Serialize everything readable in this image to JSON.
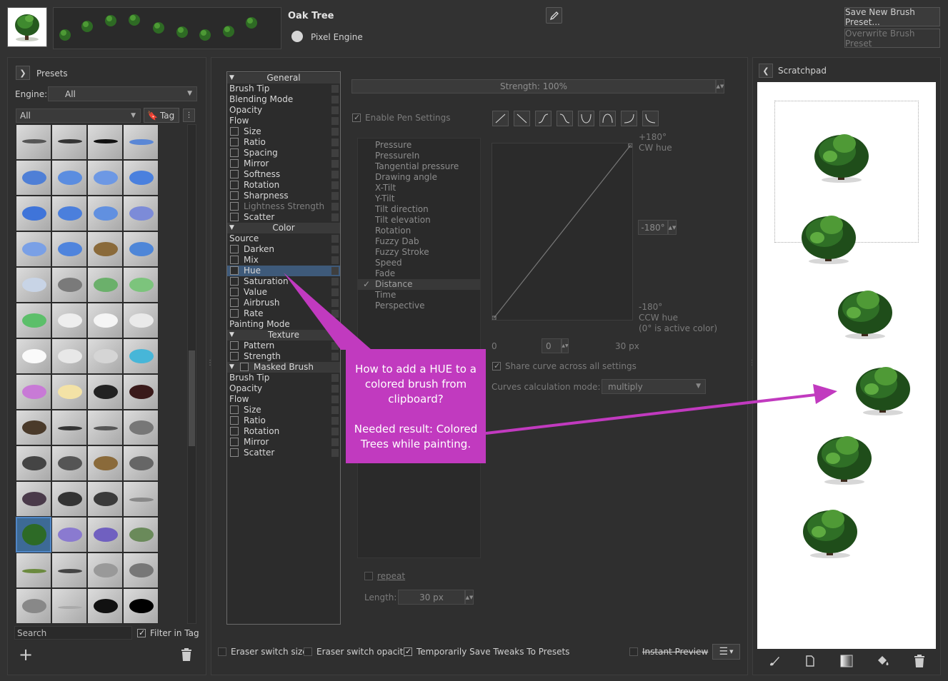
{
  "header": {
    "preset_name": "Oak Tree",
    "engine_label": "Pixel Engine",
    "save_new_label": "Save New Brush Preset...",
    "overwrite_label": "Overwrite Brush Preset"
  },
  "presets": {
    "title": "Presets",
    "engine_label": "Engine:",
    "engine_value": "All",
    "tag_filter_value": "All",
    "tag_button": "Tag",
    "search_placeholder": "Search",
    "filter_in_tag": "Filter in Tag"
  },
  "settings_list": {
    "items": [
      {
        "label": "General",
        "kind": "header"
      },
      {
        "label": "Brush Tip",
        "kind": "plain"
      },
      {
        "label": "Blending Mode",
        "kind": "plain"
      },
      {
        "label": "Opacity",
        "kind": "plain"
      },
      {
        "label": "Flow",
        "kind": "plain"
      },
      {
        "label": "Size",
        "kind": "check"
      },
      {
        "label": "Ratio",
        "kind": "check"
      },
      {
        "label": "Spacing",
        "kind": "check"
      },
      {
        "label": "Mirror",
        "kind": "check"
      },
      {
        "label": "Softness",
        "kind": "check"
      },
      {
        "label": "Rotation",
        "kind": "check"
      },
      {
        "label": "Sharpness",
        "kind": "check"
      },
      {
        "label": "Lightness Strength",
        "kind": "check-disabled"
      },
      {
        "label": "Scatter",
        "kind": "check"
      },
      {
        "label": "Color",
        "kind": "header"
      },
      {
        "label": "Source",
        "kind": "plain"
      },
      {
        "label": "Darken",
        "kind": "check"
      },
      {
        "label": "Mix",
        "kind": "check"
      },
      {
        "label": "Hue",
        "kind": "check-selected"
      },
      {
        "label": "Saturation",
        "kind": "check"
      },
      {
        "label": "Value",
        "kind": "check"
      },
      {
        "label": "Airbrush",
        "kind": "check"
      },
      {
        "label": "Rate",
        "kind": "check"
      },
      {
        "label": "Painting Mode",
        "kind": "plain"
      },
      {
        "label": "Texture",
        "kind": "header"
      },
      {
        "label": "Pattern",
        "kind": "check"
      },
      {
        "label": "Strength",
        "kind": "check"
      },
      {
        "label": "Masked Brush",
        "kind": "header-check"
      },
      {
        "label": "Brush Tip",
        "kind": "plain"
      },
      {
        "label": "Opacity",
        "kind": "plain"
      },
      {
        "label": "Flow",
        "kind": "plain"
      },
      {
        "label": "Size",
        "kind": "check"
      },
      {
        "label": "Ratio",
        "kind": "check"
      },
      {
        "label": "Rotation",
        "kind": "check"
      },
      {
        "label": "Mirror",
        "kind": "check"
      },
      {
        "label": "Scatter",
        "kind": "check"
      }
    ]
  },
  "hue_options": {
    "strength_label": "Strength: 100%",
    "strength_value": 100,
    "enable_pen_settings": "Enable Pen Settings",
    "sensors": [
      "Pressure",
      "PressureIn",
      "Tangential pressure",
      "Drawing angle",
      "X-Tilt",
      "Y-Tilt",
      "Tilt direction",
      "Tilt elevation",
      "Rotation",
      "Fuzzy Dab",
      "Fuzzy Stroke",
      "Speed",
      "Fade",
      "Distance",
      "Time",
      "Perspective"
    ],
    "active_sensor": "Distance",
    "y_top_label": "+180°",
    "y_top_sub": "CW hue",
    "y_mid_value": "-180°",
    "y_bottom_label": "-180°",
    "y_bottom_sub": "CCW hue",
    "y_bottom_note": "(0° is active color)",
    "x_min": "0",
    "x_value": "0",
    "x_max": "30 px",
    "share_curve": "Share curve across all settings",
    "calc_mode_label": "Curves calculation mode:",
    "calc_mode_value": "multiply",
    "repeat_label": "repeat",
    "length_label": "Length:",
    "length_value": "30 px"
  },
  "footer": {
    "eraser_size": "Eraser switch size",
    "eraser_opacity": "Eraser switch opacity",
    "save_tweaks": "Temporarily Save Tweaks To Presets",
    "instant_preview": "Instant Preview"
  },
  "scratchpad": {
    "title": "Scratchpad"
  },
  "callout": {
    "question": "How to add a HUE to a colored brush from clipboard?",
    "result": "Needed result: Colored Trees while painting."
  },
  "colors": {
    "callout": "#c13abf",
    "selection": "#3e5a7a",
    "tree_dark": "#1f4d1a",
    "tree_light": "#4f9a36"
  }
}
